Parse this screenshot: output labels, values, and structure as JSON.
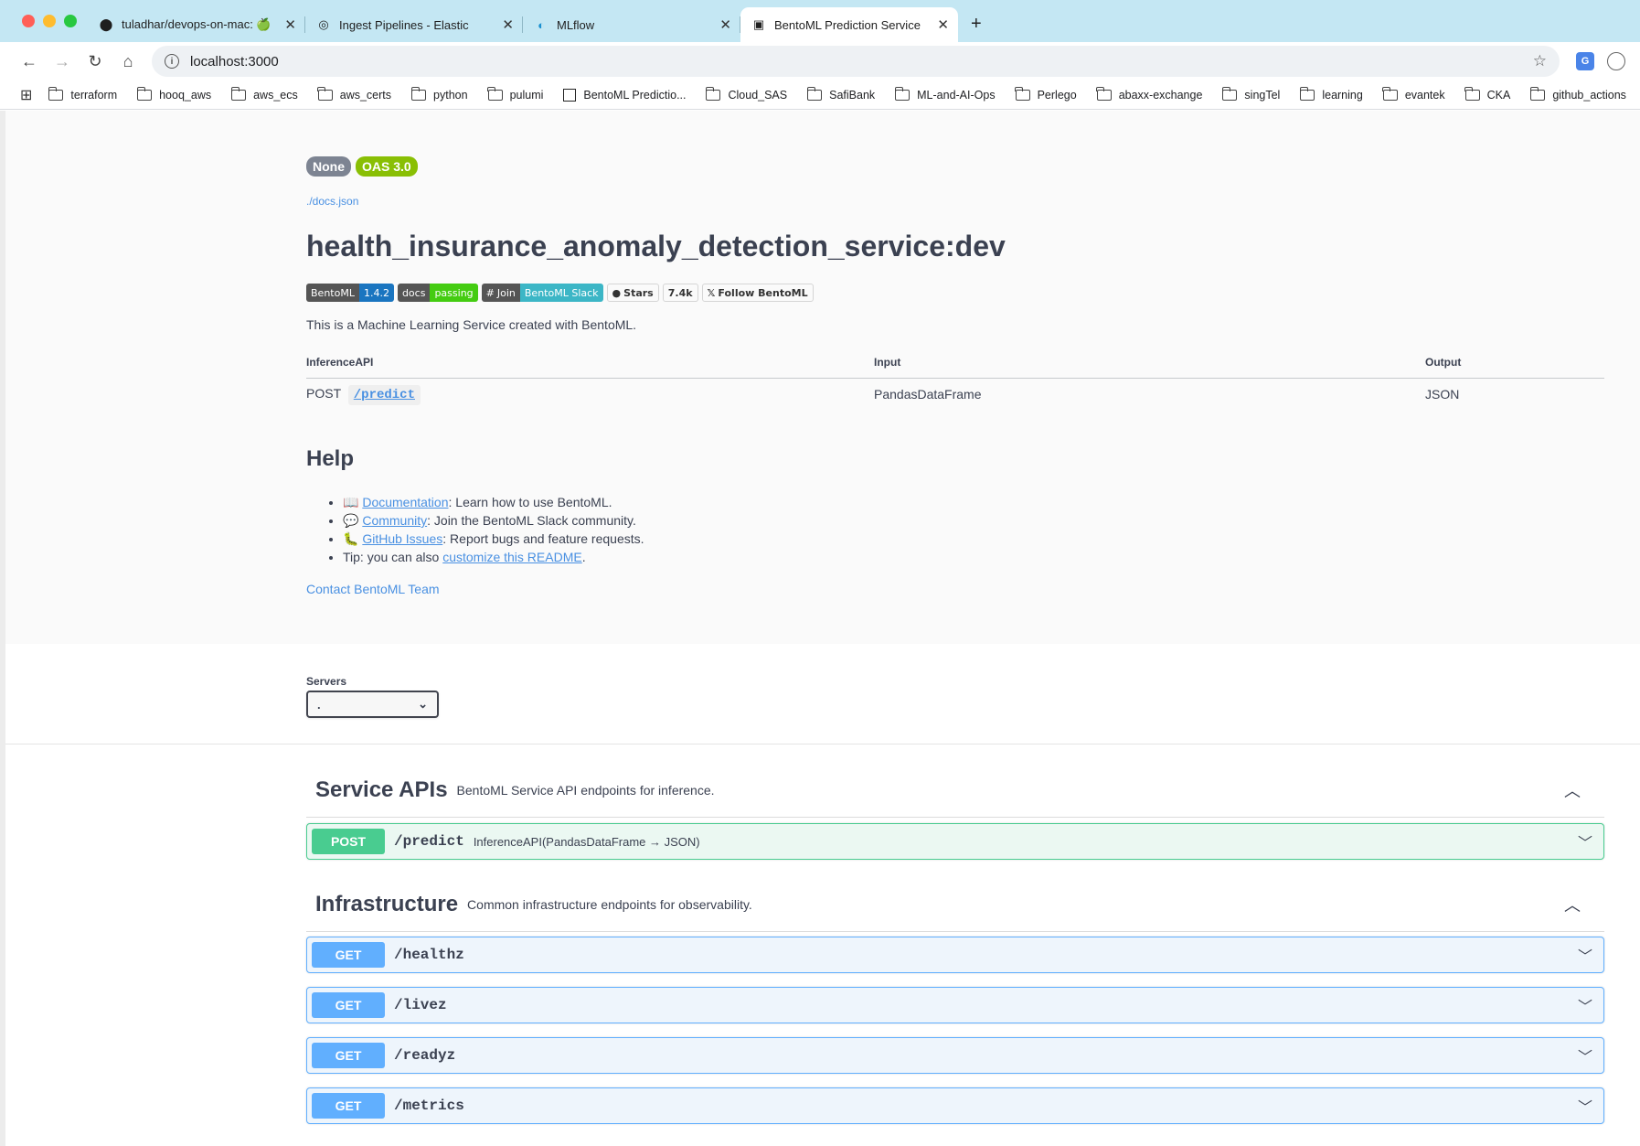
{
  "browser": {
    "tabs": [
      {
        "title": "tuladhar/devops-on-mac: 🍏",
        "icon": "github-icon"
      },
      {
        "title": "Ingest Pipelines - Elastic",
        "icon": "elastic-icon"
      },
      {
        "title": "MLflow",
        "icon": "mlflow-icon"
      },
      {
        "title": "BentoML Prediction Service",
        "icon": "bentoml-icon",
        "active": true
      }
    ],
    "address": "localhost:3000",
    "bookmarks": [
      {
        "label": "terraform",
        "type": "folder"
      },
      {
        "label": "hooq_aws",
        "type": "folder"
      },
      {
        "label": "aws_ecs",
        "type": "folder"
      },
      {
        "label": "aws_certs",
        "type": "folder"
      },
      {
        "label": "python",
        "type": "folder"
      },
      {
        "label": "pulumi",
        "type": "folder"
      },
      {
        "label": "BentoML Predictio...",
        "type": "page"
      },
      {
        "label": "Cloud_SAS",
        "type": "folder"
      },
      {
        "label": "SafiBank",
        "type": "folder"
      },
      {
        "label": "ML-and-AI-Ops",
        "type": "folder"
      },
      {
        "label": "Perlego",
        "type": "folder"
      },
      {
        "label": "abaxx-exchange",
        "type": "folder"
      },
      {
        "label": "singTel",
        "type": "folder"
      },
      {
        "label": "learning",
        "type": "folder"
      },
      {
        "label": "evantek",
        "type": "folder"
      },
      {
        "label": "CKA",
        "type": "folder"
      },
      {
        "label": "github_actions",
        "type": "folder"
      }
    ]
  },
  "info": {
    "badges": [
      "None",
      "OAS 3.0"
    ],
    "docs_link": "./docs.json",
    "title": "health_insurance_anomaly_detection_service:dev",
    "shields": {
      "bentoml": [
        "BentoML",
        "1.4.2"
      ],
      "docs": [
        "docs",
        "passing"
      ],
      "slack": [
        "Join",
        "BentoML Slack"
      ],
      "stars": [
        "Stars",
        "7.4k"
      ],
      "follow": "Follow BentoML"
    },
    "description": "This is a Machine Learning Service created with BentoML.",
    "table": {
      "headers": [
        "InferenceAPI",
        "Input",
        "Output"
      ],
      "rows": [
        {
          "method": "POST",
          "path": "/predict",
          "input": "PandasDataFrame",
          "output": "JSON"
        }
      ]
    },
    "help_title": "Help",
    "help": [
      {
        "emoji": "📖",
        "link": "Documentation",
        "text": ": Learn how to use BentoML."
      },
      {
        "emoji": "💬",
        "link": "Community",
        "text": ": Join the BentoML Slack community."
      },
      {
        "emoji": "🐛",
        "link": "GitHub Issues",
        "text": ": Report bugs and feature requests."
      },
      {
        "prefix": "Tip: you can also ",
        "link": "customize this README",
        "suffix": "."
      }
    ],
    "contact": "Contact BentoML Team"
  },
  "servers": {
    "label": "Servers",
    "selected": "."
  },
  "sections": [
    {
      "title": "Service APIs",
      "description": "BentoML Service API endpoints for inference.",
      "ops": [
        {
          "method": "POST",
          "path": "/predict",
          "summary": "InferenceAPI(PandasDataFrame → JSON)"
        }
      ]
    },
    {
      "title": "Infrastructure",
      "description": "Common infrastructure endpoints for observability.",
      "ops": [
        {
          "method": "GET",
          "path": "/healthz",
          "summary": ""
        },
        {
          "method": "GET",
          "path": "/livez",
          "summary": ""
        },
        {
          "method": "GET",
          "path": "/readyz",
          "summary": ""
        },
        {
          "method": "GET",
          "path": "/metrics",
          "summary": ""
        }
      ]
    }
  ],
  "colors": {
    "post": "#49cc90",
    "get": "#61affe",
    "link": "#4990e2",
    "oas_badge": "#89bf04"
  }
}
